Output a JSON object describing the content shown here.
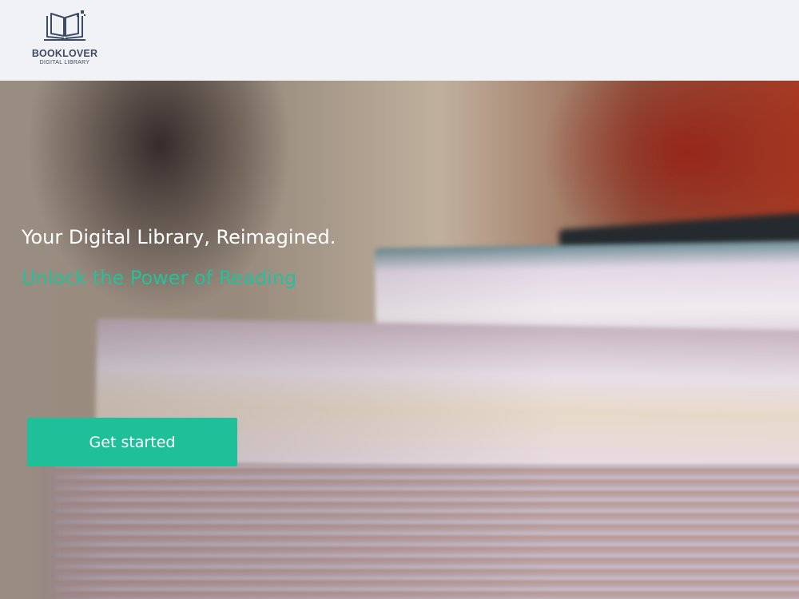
{
  "brand": {
    "name": "BOOKLOVER",
    "tagline": "DIGITAL LIBRARY",
    "icon": "open-book-icon"
  },
  "hero": {
    "background_image": "stacked-books-photo",
    "title": "Your Digital Library, Reimagined.",
    "subtitle": "Unlock the Power of Reading",
    "cta_label": "Get started"
  },
  "colors": {
    "accent": "#1fbf9a",
    "header_bg": "#f0f2f6",
    "brand_text": "#3d4c64"
  }
}
